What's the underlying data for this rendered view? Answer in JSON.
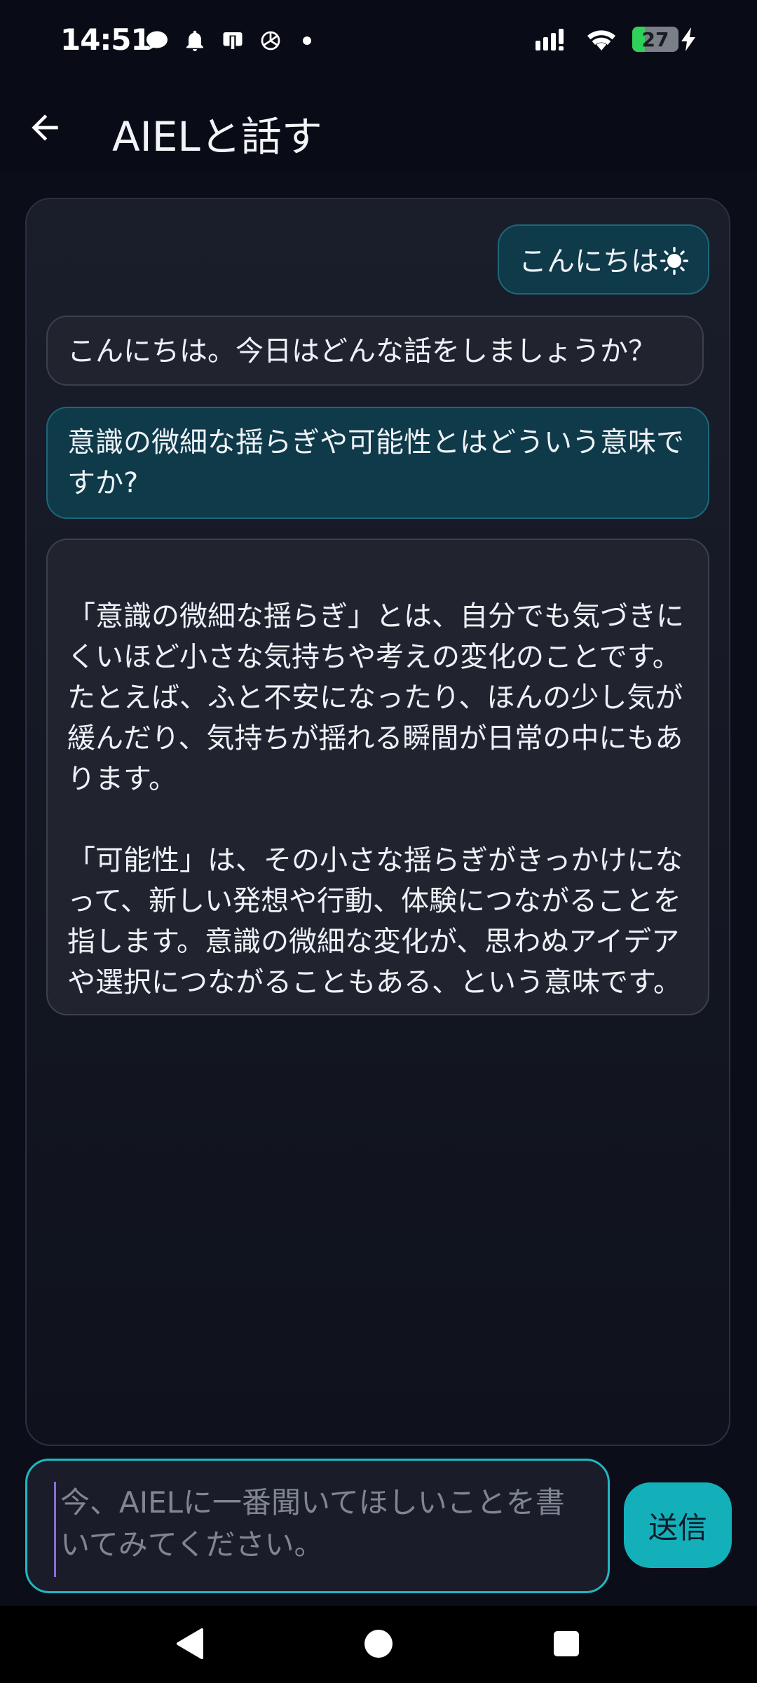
{
  "status_bar": {
    "time": "14:51",
    "battery_level": "27",
    "battery_fraction": 0.27,
    "left_icons": [
      "chat-bubble-icon",
      "notification-bell-icon",
      "cast-icon",
      "openai-icon",
      "more-dot-icon"
    ],
    "right_icons": [
      "signal-icon",
      "wifi-icon",
      "battery-icon",
      "charging-icon"
    ]
  },
  "app_bar": {
    "title": "AIELと話す",
    "back_icon": "back-arrow-icon"
  },
  "messages": [
    {
      "role": "user",
      "text": "こんにちは",
      "trailing_icon": "sun-icon"
    },
    {
      "role": "assistant",
      "text": "こんにちは。今日はどんな話をしましょうか？"
    },
    {
      "role": "user",
      "text": "意識の微細な揺らぎや可能性とはどういう意味ですか?"
    },
    {
      "role": "assistant",
      "text": "「意識の微細な揺らぎ」とは、自分でも気づきにくいほど小さな気持ちや考えの変化のことです。たとえば、ふと不安になったり、ほんの少し気が緩んだり、気持ちが揺れる瞬間が日常の中にもあります。\n\n「可能性」は、その小さな揺らぎがきっかけになって、新しい発想や行動、体験につながることを指します。意識の微細な変化が、思わぬアイデアや選択につながることもある、という意味です。"
    }
  ],
  "input": {
    "placeholder": "今、AIELに一番聞いてほしいことを書いてみてください。",
    "value": ""
  },
  "send_button": {
    "label": "送信"
  },
  "colors": {
    "background": "#0b0e18",
    "user_bubble": "#0e3a4a",
    "assistant_bubble": "#21242f",
    "accent": "#14b0ba",
    "battery": "#2fd15a"
  }
}
